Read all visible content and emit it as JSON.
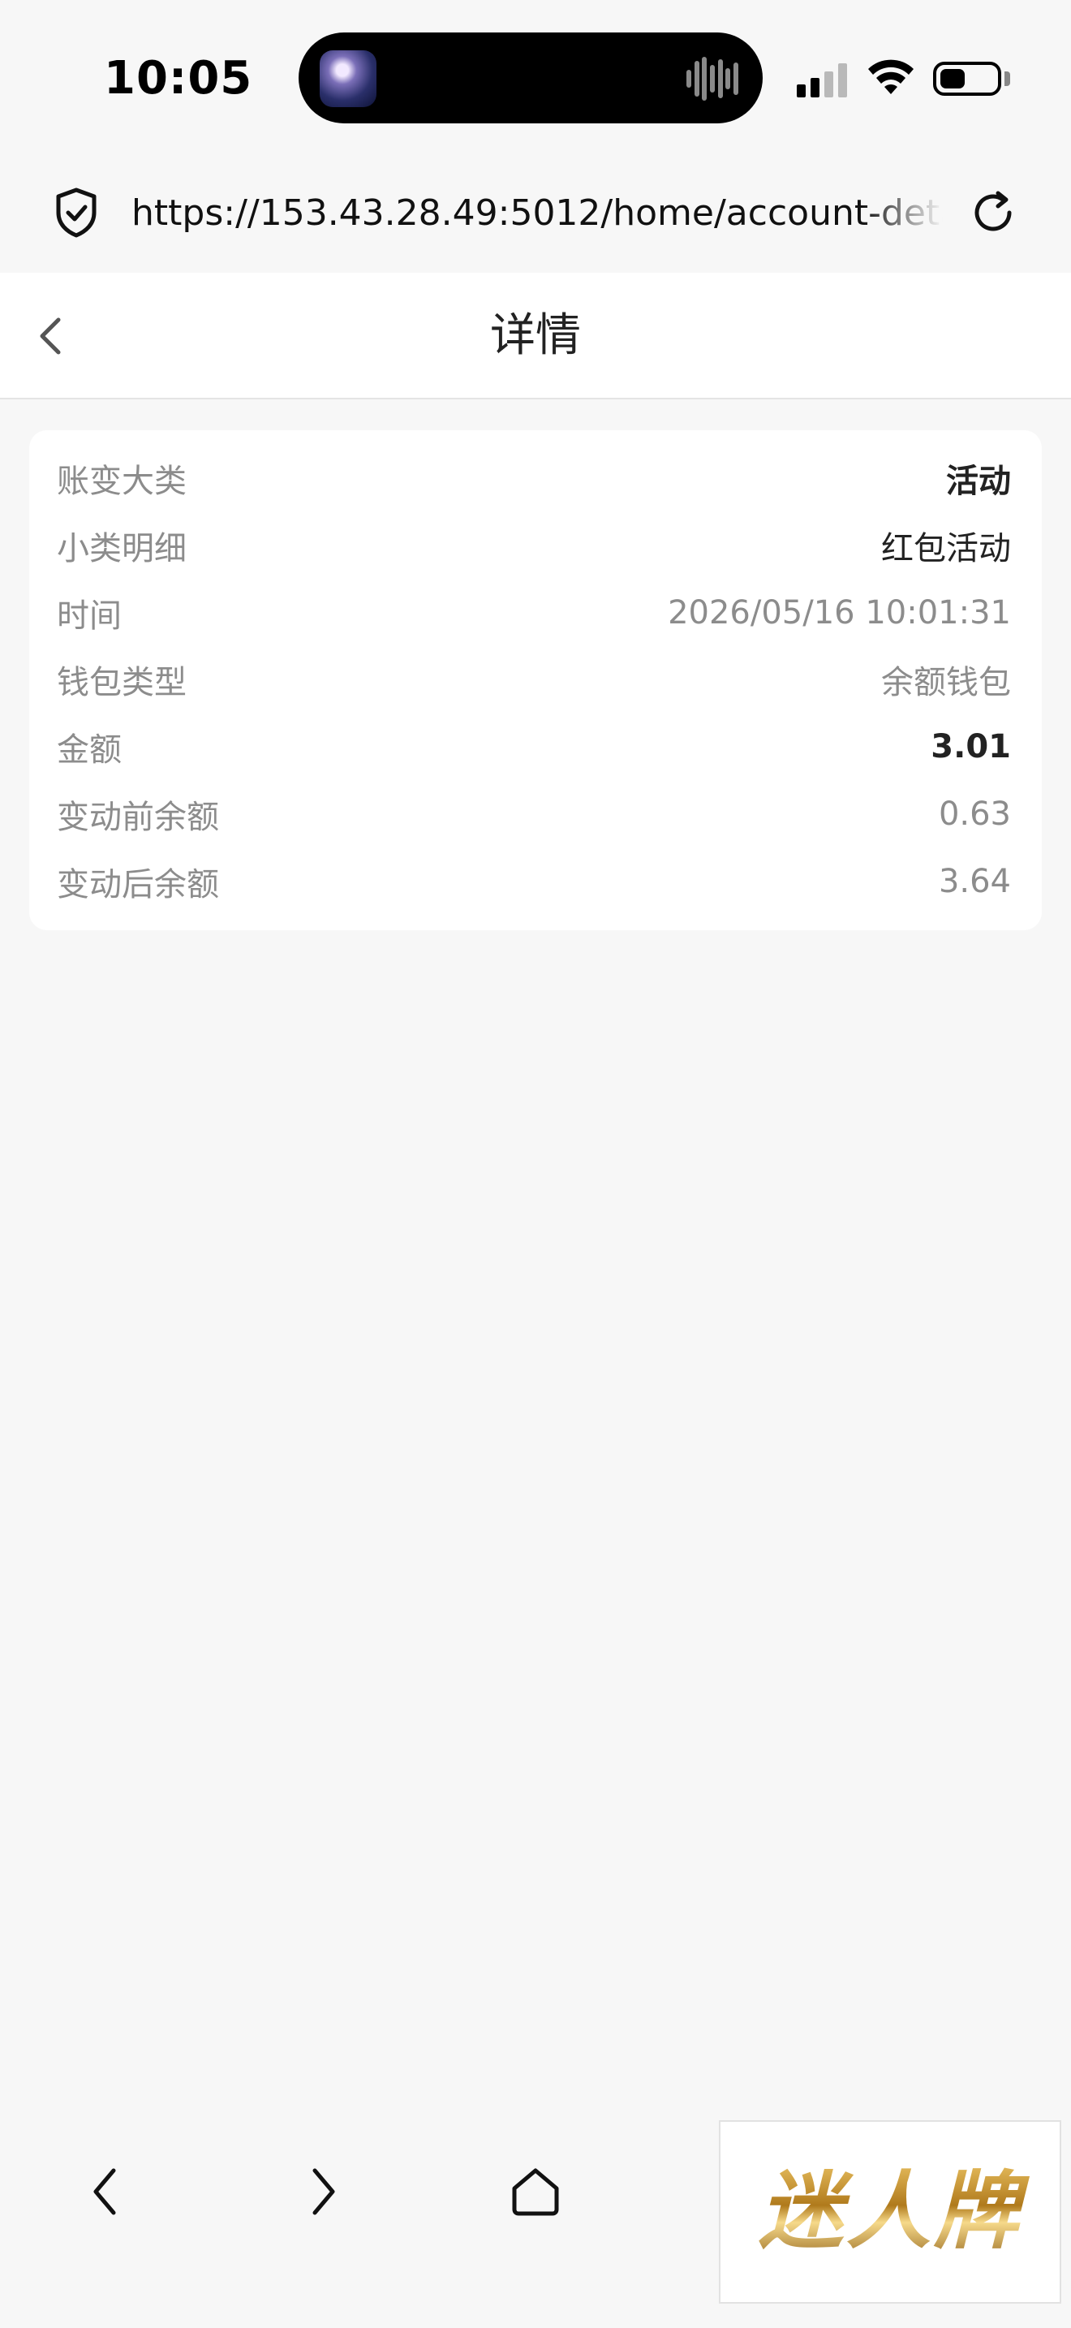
{
  "status_bar": {
    "time": "10:05",
    "battery_level": 0.45
  },
  "browser": {
    "url": "https://153.43.28.49:5012/home/account-detail?"
  },
  "header": {
    "title": "详情"
  },
  "detail": {
    "rows": [
      {
        "label": "账变大类",
        "value": "活动"
      },
      {
        "label": "小类明细",
        "value": "红包活动"
      },
      {
        "label": "时间",
        "value": "2026/05/16 10:01:31"
      },
      {
        "label": "钱包类型",
        "value": "余额钱包"
      },
      {
        "label": "金额",
        "value": "3.01"
      },
      {
        "label": "变动前余额",
        "value": "0.63"
      },
      {
        "label": "变动后余额",
        "value": "3.64"
      }
    ]
  },
  "watermark": {
    "text": "迷人牌"
  },
  "colors": {
    "background": "#f7f7f7",
    "card": "#ffffff",
    "label": "#8c8c8c",
    "emphasis": "#222222",
    "logo_gold": "#b07a1c"
  },
  "icons": {
    "status": [
      "signal-icon",
      "wifi-icon",
      "battery-icon"
    ],
    "browser": [
      "shield-check-icon",
      "reload-icon"
    ],
    "header": [
      "chevron-left-icon"
    ],
    "toolbar": [
      "back-icon",
      "forward-icon",
      "home-icon"
    ]
  }
}
